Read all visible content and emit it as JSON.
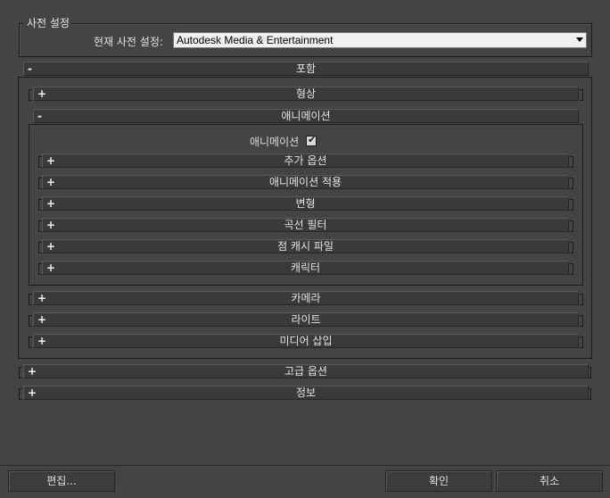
{
  "preset": {
    "group_title": "사전 설정",
    "current_label": "현재 사전 설정:",
    "selected": "Autodesk Media & Entertainment"
  },
  "include": {
    "sign": "-",
    "title": "포함",
    "shape": {
      "sign": "+",
      "title": "형상"
    },
    "animation": {
      "sign": "-",
      "title": "애니메이션",
      "checkbox_label": "애니메이션",
      "checkbox_checked": true,
      "items": [
        {
          "sign": "+",
          "title": "추가 옵션"
        },
        {
          "sign": "+",
          "title": "애니메이션 적용"
        },
        {
          "sign": "+",
          "title": "변형"
        },
        {
          "sign": "+",
          "title": "곡선 필터"
        },
        {
          "sign": "+",
          "title": "점 캐시 파일"
        },
        {
          "sign": "+",
          "title": "캐릭터"
        }
      ]
    },
    "camera": {
      "sign": "+",
      "title": "카메라"
    },
    "lights": {
      "sign": "+",
      "title": "라이트"
    },
    "embed_media": {
      "sign": "+",
      "title": "미디어 삽입"
    }
  },
  "advanced": {
    "sign": "+",
    "title": "고급 옵션"
  },
  "info": {
    "sign": "+",
    "title": "정보"
  },
  "buttons": {
    "edit": "편집...",
    "ok": "확인",
    "cancel": "취소"
  },
  "colors": {
    "background": "#444444",
    "rollout": "#3a3a3a",
    "text": "#dcdcdc"
  }
}
